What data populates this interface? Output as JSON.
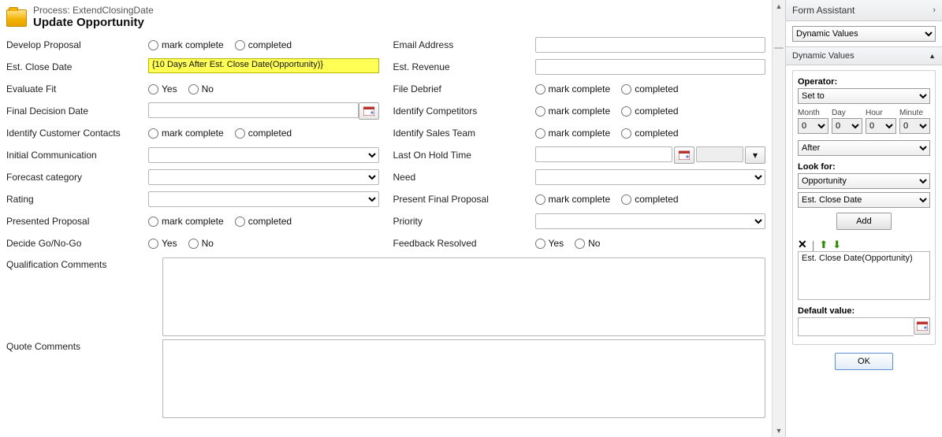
{
  "header": {
    "process_label": "Process:",
    "process_name": "ExtendClosingDate",
    "step_title": "Update Opportunity"
  },
  "opts": {
    "mark_complete": "mark complete",
    "completed": "completed",
    "yes": "Yes",
    "no": "No"
  },
  "left": {
    "develop_proposal": {
      "label": "Develop Proposal"
    },
    "est_close_date": {
      "label": "Est. Close Date",
      "value": "{10 Days After Est. Close Date(Opportunity)}"
    },
    "evaluate_fit": {
      "label": "Evaluate Fit"
    },
    "final_decision_date": {
      "label": "Final Decision Date"
    },
    "identify_customer_contacts": {
      "label": "Identify Customer Contacts"
    },
    "initial_communication": {
      "label": "Initial Communication"
    },
    "forecast_category": {
      "label": "Forecast category"
    },
    "rating": {
      "label": "Rating"
    },
    "presented_proposal": {
      "label": "Presented Proposal"
    },
    "decide_go_no_go": {
      "label": "Decide Go/No-Go"
    }
  },
  "right": {
    "email_address": {
      "label": "Email Address"
    },
    "est_revenue": {
      "label": "Est. Revenue"
    },
    "file_debrief": {
      "label": "File Debrief"
    },
    "identify_competitors": {
      "label": "Identify Competitors"
    },
    "identify_sales_team": {
      "label": "Identify Sales Team"
    },
    "last_on_hold_time": {
      "label": "Last On Hold Time"
    },
    "need": {
      "label": "Need"
    },
    "present_final_proposal": {
      "label": "Present Final Proposal"
    },
    "priority": {
      "label": "Priority"
    },
    "feedback_resolved": {
      "label": "Feedback Resolved"
    }
  },
  "full": {
    "qualification_comments": {
      "label": "Qualification Comments"
    },
    "quote_comments": {
      "label": "Quote Comments"
    }
  },
  "fa": {
    "title": "Form Assistant",
    "mode": "Dynamic Values",
    "section": "Dynamic Values",
    "operator_label": "Operator:",
    "operator_value": "Set to",
    "months_label": "Month",
    "days_label": "Day",
    "hours_label": "Hour",
    "minutes_label": "Minute",
    "months": "0",
    "days": "0",
    "hours": "0",
    "minutes": "0",
    "before_after": "After",
    "look_for_label": "Look for:",
    "entity": "Opportunity",
    "attribute": "Est. Close Date",
    "add_label": "Add",
    "selected_item": "Est. Close Date(Opportunity)",
    "default_value_label": "Default value:",
    "ok_label": "OK"
  }
}
